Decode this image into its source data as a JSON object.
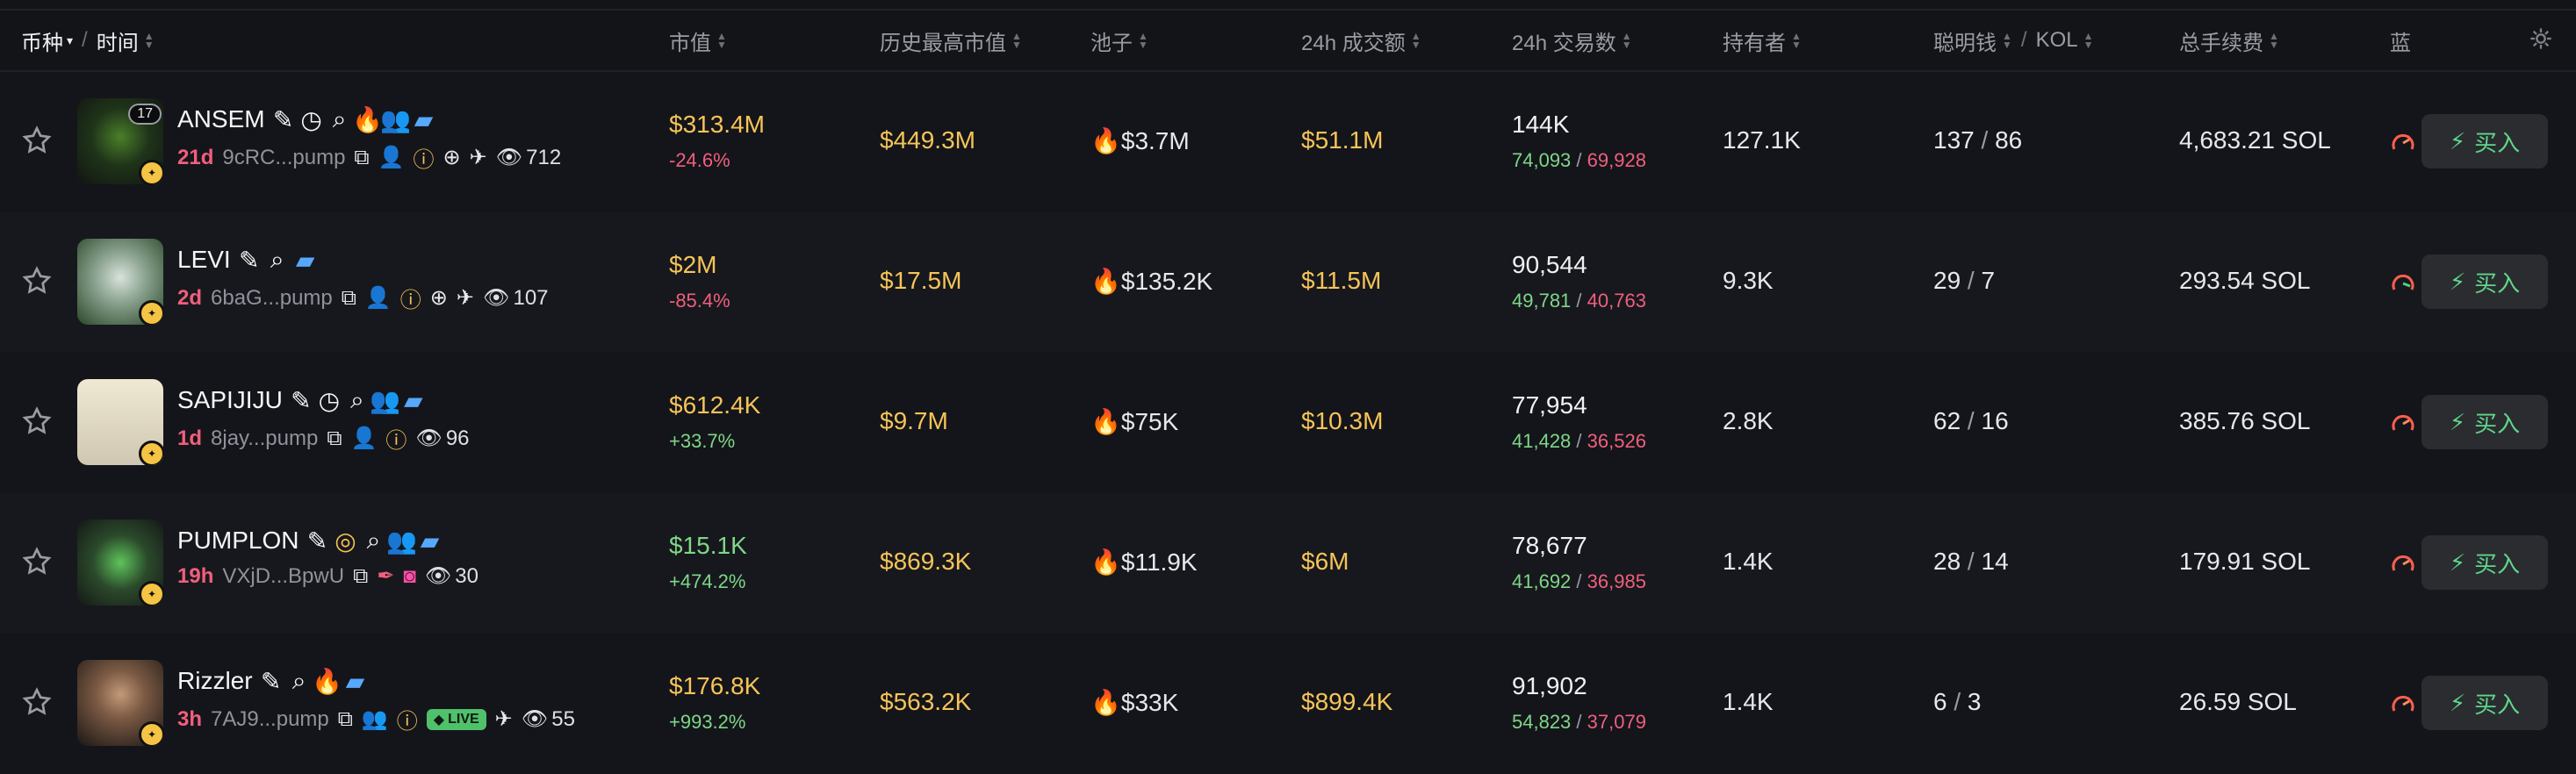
{
  "header": {
    "token_label": "币种",
    "time_label": "时间",
    "market_cap": "市值",
    "ath_market_cap": "历史最高市值",
    "pool": "池子",
    "volume_24h": "24h 成交额",
    "txns_24h": "24h 交易数",
    "holders": "持有者",
    "smart_money": "聪明钱",
    "kol": "KOL",
    "total_fees": "总手续费",
    "blue_chip": "蓝"
  },
  "rows": [
    {
      "name": "ANSEM",
      "age": "21d",
      "address": "9cRC...pump",
      "views": "712",
      "badge_count": "17",
      "market_cap": "$313.4M",
      "market_cap_change": "-24.6%",
      "ath": "$449.3M",
      "pool": "$3.7M",
      "volume": "$51.1M",
      "txns": "144K",
      "buys": "74,093",
      "sells": "69,928",
      "holders": "127.1K",
      "smart": "137",
      "kol": "86",
      "fees": "4,683.21 SOL",
      "buy_label": "买入"
    },
    {
      "name": "LEVI",
      "age": "2d",
      "address": "6baG...pump",
      "views": "107",
      "market_cap": "$2M",
      "market_cap_change": "-85.4%",
      "ath": "$17.5M",
      "pool": "$135.2K",
      "volume": "$11.5M",
      "txns": "90,544",
      "buys": "49,781",
      "sells": "40,763",
      "holders": "9.3K",
      "smart": "29",
      "kol": "7",
      "fees": "293.54 SOL",
      "buy_label": "买入"
    },
    {
      "name": "SAPIJIJU",
      "age": "1d",
      "address": "8jay...pump",
      "views": "96",
      "market_cap": "$612.4K",
      "market_cap_change": "+33.7%",
      "ath": "$9.7M",
      "pool": "$75K",
      "volume": "$10.3M",
      "txns": "77,954",
      "buys": "41,428",
      "sells": "36,526",
      "holders": "2.8K",
      "smart": "62",
      "kol": "16",
      "fees": "385.76 SOL",
      "buy_label": "买入"
    },
    {
      "name": "PUMPLON",
      "age": "19h",
      "address": "VXjD...BpwU",
      "views": "30",
      "market_cap": "$15.1K",
      "market_cap_change": "+474.2%",
      "ath": "$869.3K",
      "pool": "$11.9K",
      "volume": "$6M",
      "txns": "78,677",
      "buys": "41,692",
      "sells": "36,985",
      "holders": "1.4K",
      "smart": "28",
      "kol": "14",
      "fees": "179.91 SOL",
      "buy_label": "买入"
    },
    {
      "name": "Rizzler",
      "age": "3h",
      "address": "7AJ9...pump",
      "views": "55",
      "live_label": "LIVE",
      "market_cap": "$176.8K",
      "market_cap_change": "+993.2%",
      "ath": "$563.2K",
      "pool": "$33K",
      "volume": "$899.4K",
      "txns": "91,902",
      "buys": "54,823",
      "sells": "37,079",
      "holders": "1.4K",
      "smart": "6",
      "kol": "3",
      "fees": "26.59 SOL",
      "buy_label": "买入"
    }
  ],
  "colors": {
    "gold": "#f6c458",
    "green": "#7ed787",
    "red": "#f05f7d",
    "buy": "#60d68a"
  }
}
